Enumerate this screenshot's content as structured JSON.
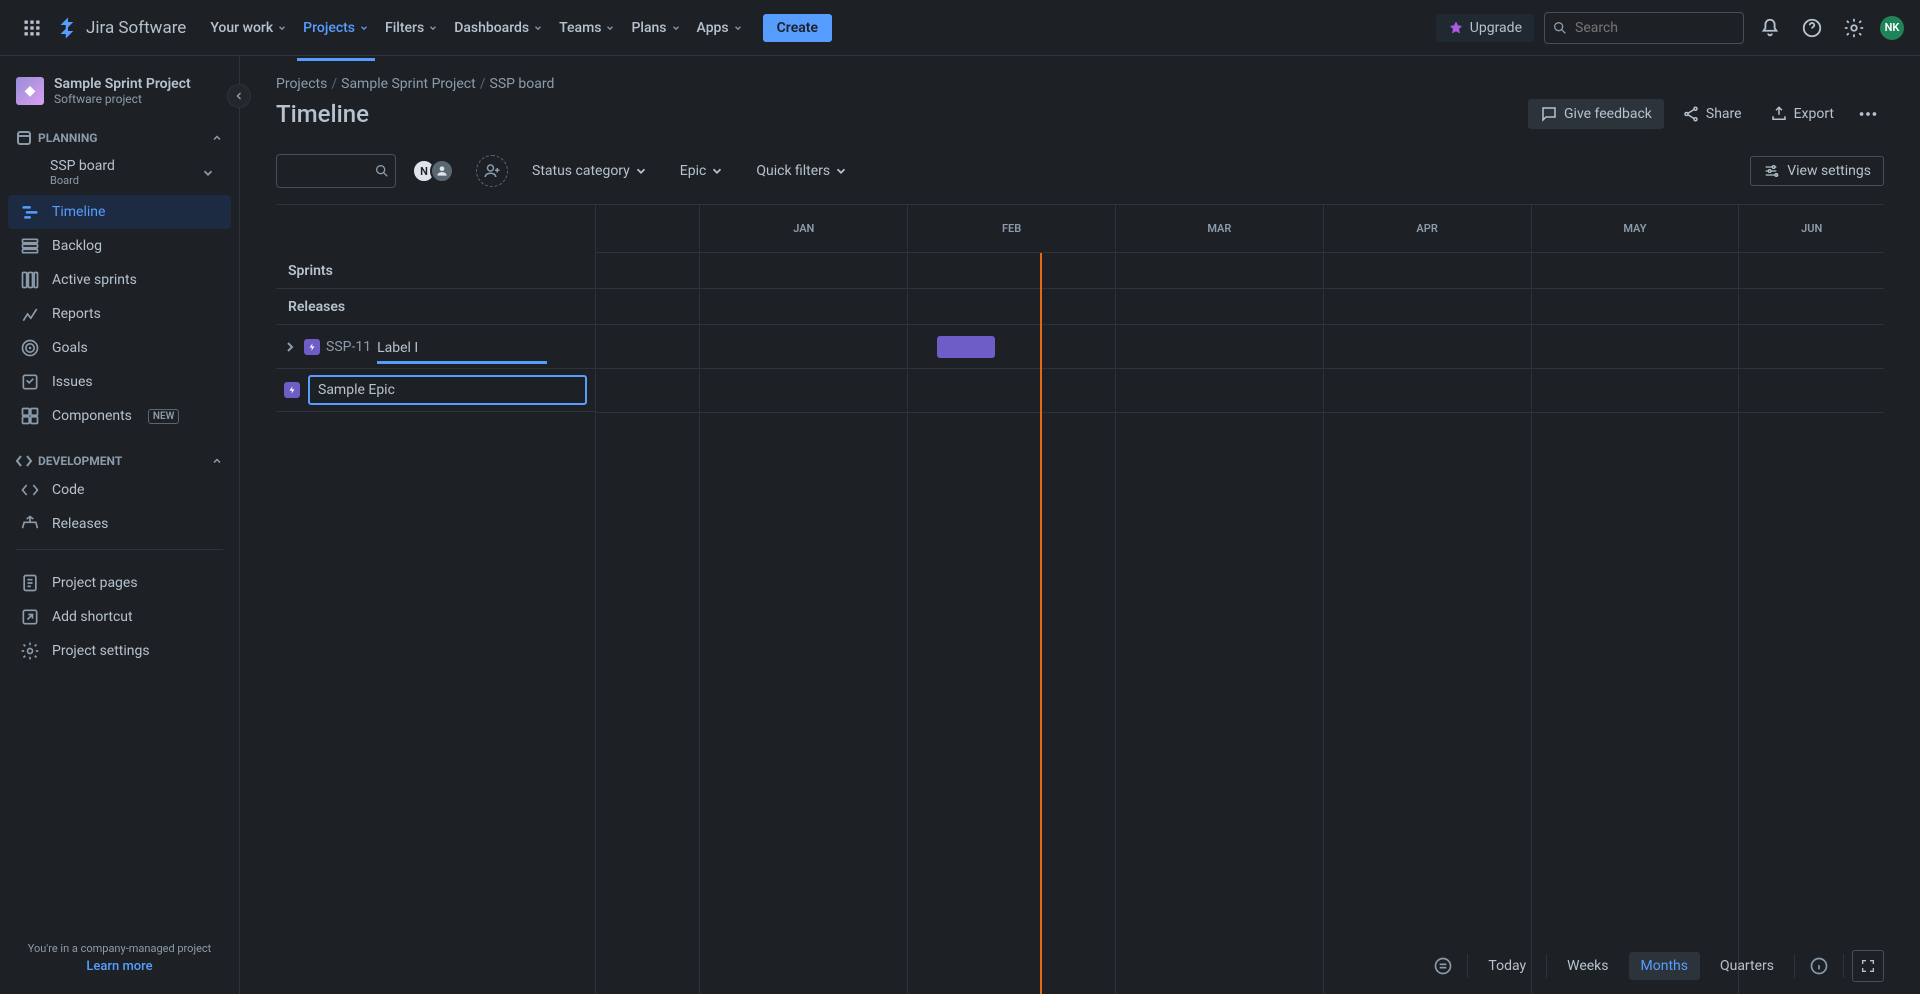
{
  "topnav": {
    "logo_text": "Jira Software",
    "items": [
      {
        "label": "Your work"
      },
      {
        "label": "Projects"
      },
      {
        "label": "Filters"
      },
      {
        "label": "Dashboards"
      },
      {
        "label": "Teams"
      },
      {
        "label": "Plans"
      },
      {
        "label": "Apps"
      }
    ],
    "create_label": "Create",
    "upgrade_label": "Upgrade",
    "search_placeholder": "Search",
    "avatar_initials": "NK"
  },
  "sidebar": {
    "project_name": "Sample Sprint Project",
    "project_sub": "Software project",
    "section_planning": "PLANNING",
    "board_name": "SSP board",
    "board_label": "Board",
    "items_planning": [
      {
        "label": "Timeline"
      },
      {
        "label": "Backlog"
      },
      {
        "label": "Active sprints"
      },
      {
        "label": "Reports"
      },
      {
        "label": "Goals"
      },
      {
        "label": "Issues"
      },
      {
        "label": "Components"
      }
    ],
    "new_badge": "NEW",
    "section_dev": "DEVELOPMENT",
    "items_dev": [
      {
        "label": "Code"
      },
      {
        "label": "Releases"
      }
    ],
    "project_links": [
      {
        "label": "Project pages"
      },
      {
        "label": "Add shortcut"
      },
      {
        "label": "Project settings"
      }
    ],
    "footer_line": "You're in a company-managed project",
    "footer_link": "Learn more"
  },
  "breadcrumb": {
    "items": [
      "Projects",
      "Sample Sprint Project",
      "SSP board"
    ]
  },
  "page": {
    "title": "Timeline",
    "feedback_btn": "Give feedback",
    "share_btn": "Share",
    "export_btn": "Export"
  },
  "toolbar": {
    "status_category": "Status category",
    "epic_label": "Epic",
    "quick_filters": "Quick filters",
    "view_settings": "View settings"
  },
  "timeline": {
    "months": [
      "JAN",
      "FEB",
      "MAR",
      "APR",
      "MAY",
      "JUN"
    ],
    "groups": [
      "Sprints",
      "Releases"
    ],
    "epic": {
      "key": "SSP-11",
      "title": "Label I"
    },
    "create_placeholder": "Sample Epic"
  },
  "footer": {
    "today": "Today",
    "weeks": "Weeks",
    "months": "Months",
    "quarters": "Quarters"
  }
}
